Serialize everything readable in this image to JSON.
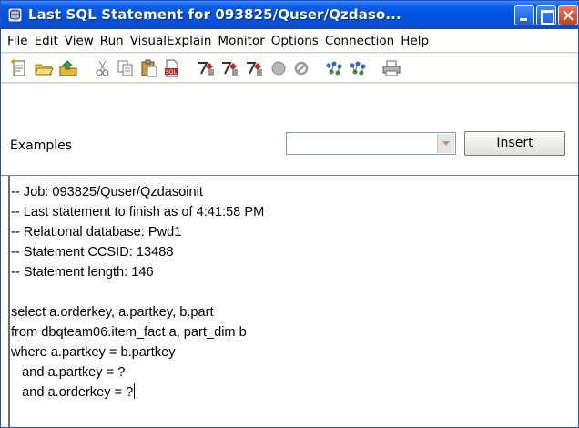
{
  "window": {
    "title": "Last SQL Statement for 093825/Quser/Qzdaso..."
  },
  "menu": [
    "File",
    "Edit",
    "View",
    "Run",
    "VisualExplain",
    "Monitor",
    "Options",
    "Connection",
    "Help"
  ],
  "toolbar": {
    "icons": [
      "new-icon",
      "open-icon",
      "save-icon",
      "cut-icon",
      "copy-icon",
      "paste-icon",
      "sql-insert-icon",
      "run-all-icon",
      "run-selected-icon",
      "run-from-cursor-icon",
      "stop-icon",
      "cancel-icon",
      "explain-icon",
      "run-explain-icon",
      "print-icon"
    ]
  },
  "examples": {
    "label": "Examples",
    "selected": "",
    "insert_label": "Insert"
  },
  "editor": {
    "lines": [
      "-- Job: 093825/Quser/Qzdasoinit",
      "-- Last statement to finish as of 4:41:58 PM",
      "-- Relational database: Pwd1",
      "-- Statement CCSID: 13488",
      "-- Statement length: 146",
      "",
      "select a.orderkey, a.partkey, b.part",
      "from dbqteam06.item_fact a, part_dim b",
      "where a.partkey = b.partkey",
      "   and a.partkey = ?",
      "   and a.orderkey = ?"
    ]
  }
}
